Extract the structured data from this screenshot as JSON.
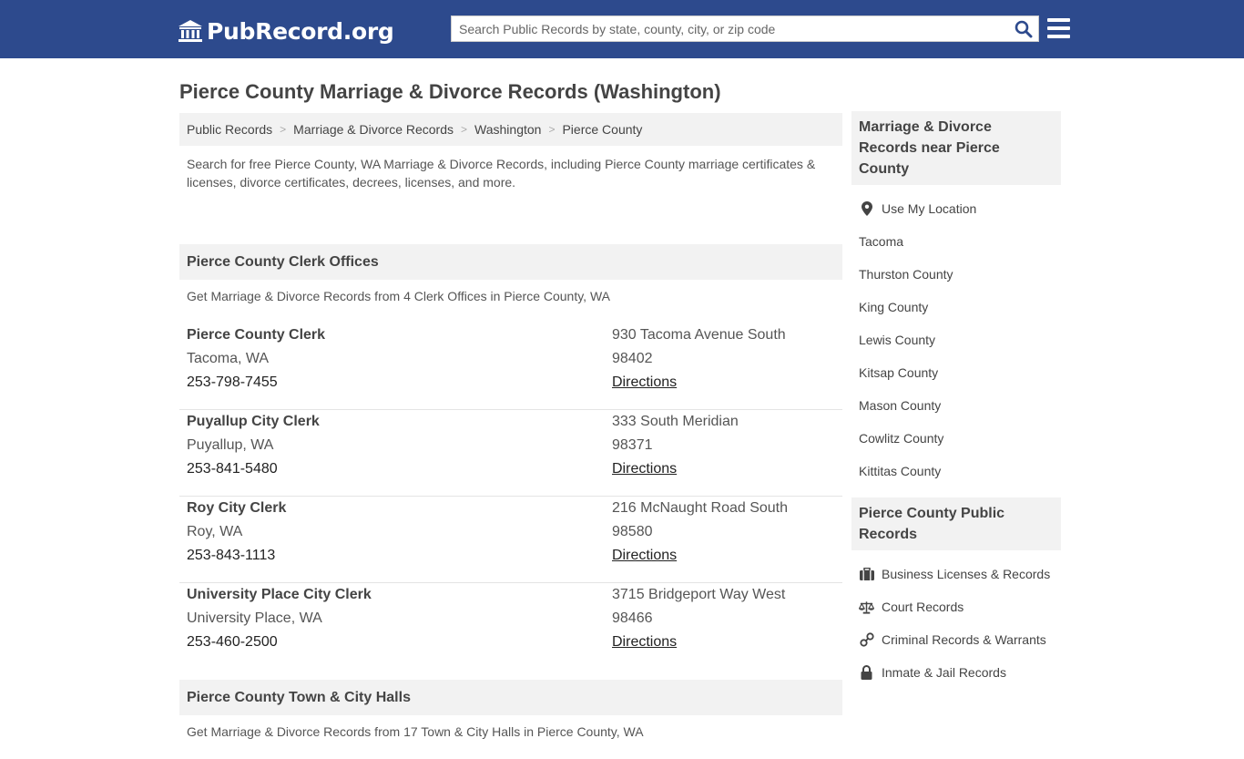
{
  "header": {
    "logo_text": "PubRecord.org",
    "search_placeholder": "Search Public Records by state, county, city, or zip code"
  },
  "page_title": "Pierce County Marriage & Divorce Records (Washington)",
  "breadcrumb": [
    "Public Records",
    "Marriage & Divorce Records",
    "Washington",
    "Pierce County"
  ],
  "intro": "Search for free Pierce County, WA Marriage & Divorce Records, including Pierce County marriage certificates & licenses, divorce certificates, decrees, licenses, and more.",
  "clerk_section": {
    "title": "Pierce County Clerk Offices",
    "subtitle": "Get Marriage & Divorce Records from 4 Clerk Offices in Pierce County, WA",
    "offices": [
      {
        "name": "Pierce County Clerk",
        "city": "Tacoma, WA",
        "phone": "253-798-7455",
        "address": "930 Tacoma Avenue South",
        "zip": "98402",
        "directions": "Directions"
      },
      {
        "name": "Puyallup City Clerk",
        "city": "Puyallup, WA",
        "phone": "253-841-5480",
        "address": "333 South Meridian",
        "zip": "98371",
        "directions": "Directions"
      },
      {
        "name": "Roy City Clerk",
        "city": "Roy, WA",
        "phone": "253-843-1113",
        "address": "216 McNaught Road South",
        "zip": "98580",
        "directions": "Directions"
      },
      {
        "name": "University Place City Clerk",
        "city": "University Place, WA",
        "phone": "253-460-2500",
        "address": "3715 Bridgeport Way West",
        "zip": "98466",
        "directions": "Directions"
      }
    ]
  },
  "halls_section": {
    "title": "Pierce County Town & City Halls",
    "subtitle": "Get Marriage & Divorce Records from 17 Town & City Halls in Pierce County, WA"
  },
  "sidebar": {
    "nearby_title": "Marriage & Divorce Records near Pierce County",
    "use_location": "Use My Location",
    "nearby": [
      "Tacoma",
      "Thurston County",
      "King County",
      "Lewis County",
      "Kitsap County",
      "Mason County",
      "Cowlitz County",
      "Kittitas County"
    ],
    "public_title": "Pierce County Public Records",
    "public_links": [
      {
        "label": "Business Licenses & Records",
        "icon": "briefcase-icon"
      },
      {
        "label": "Court Records",
        "icon": "scales-icon"
      },
      {
        "label": "Criminal Records & Warrants",
        "icon": "handcuffs-icon"
      },
      {
        "label": "Inmate & Jail Records",
        "icon": "lock-icon"
      }
    ]
  },
  "colors": {
    "header_bg": "#2d4a8d",
    "search_icon": "#2d4a8d",
    "panel_bg": "#f2f2f2"
  }
}
